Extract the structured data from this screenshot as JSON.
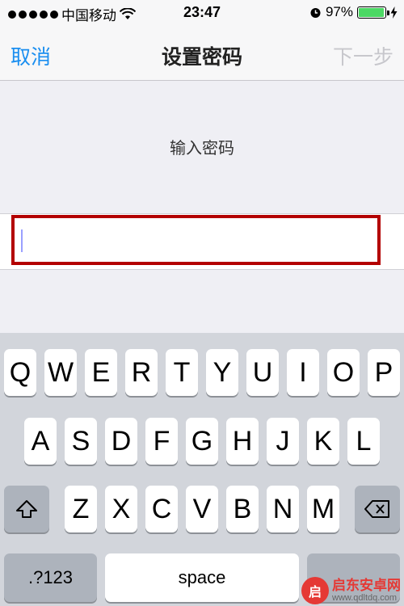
{
  "status_bar": {
    "carrier": "中国移动",
    "time": "23:47",
    "battery_percent": "97%",
    "battery_level": 0.97,
    "battery_color": "#4cd964"
  },
  "nav": {
    "cancel": "取消",
    "title": "设置密码",
    "next": "下一步"
  },
  "form": {
    "prompt": "输入密码",
    "highlight_color": "#b30000"
  },
  "keyboard": {
    "row1": [
      "Q",
      "W",
      "E",
      "R",
      "T",
      "Y",
      "U",
      "I",
      "O",
      "P"
    ],
    "row2": [
      "A",
      "S",
      "D",
      "F",
      "G",
      "H",
      "J",
      "K",
      "L"
    ],
    "row3": [
      "Z",
      "X",
      "C",
      "V",
      "B",
      "N",
      "M"
    ],
    "numbers_key": ".?123",
    "space_key": "space"
  },
  "watermark": {
    "site": "启东安卓网",
    "url": "www.qdltdq.com"
  }
}
